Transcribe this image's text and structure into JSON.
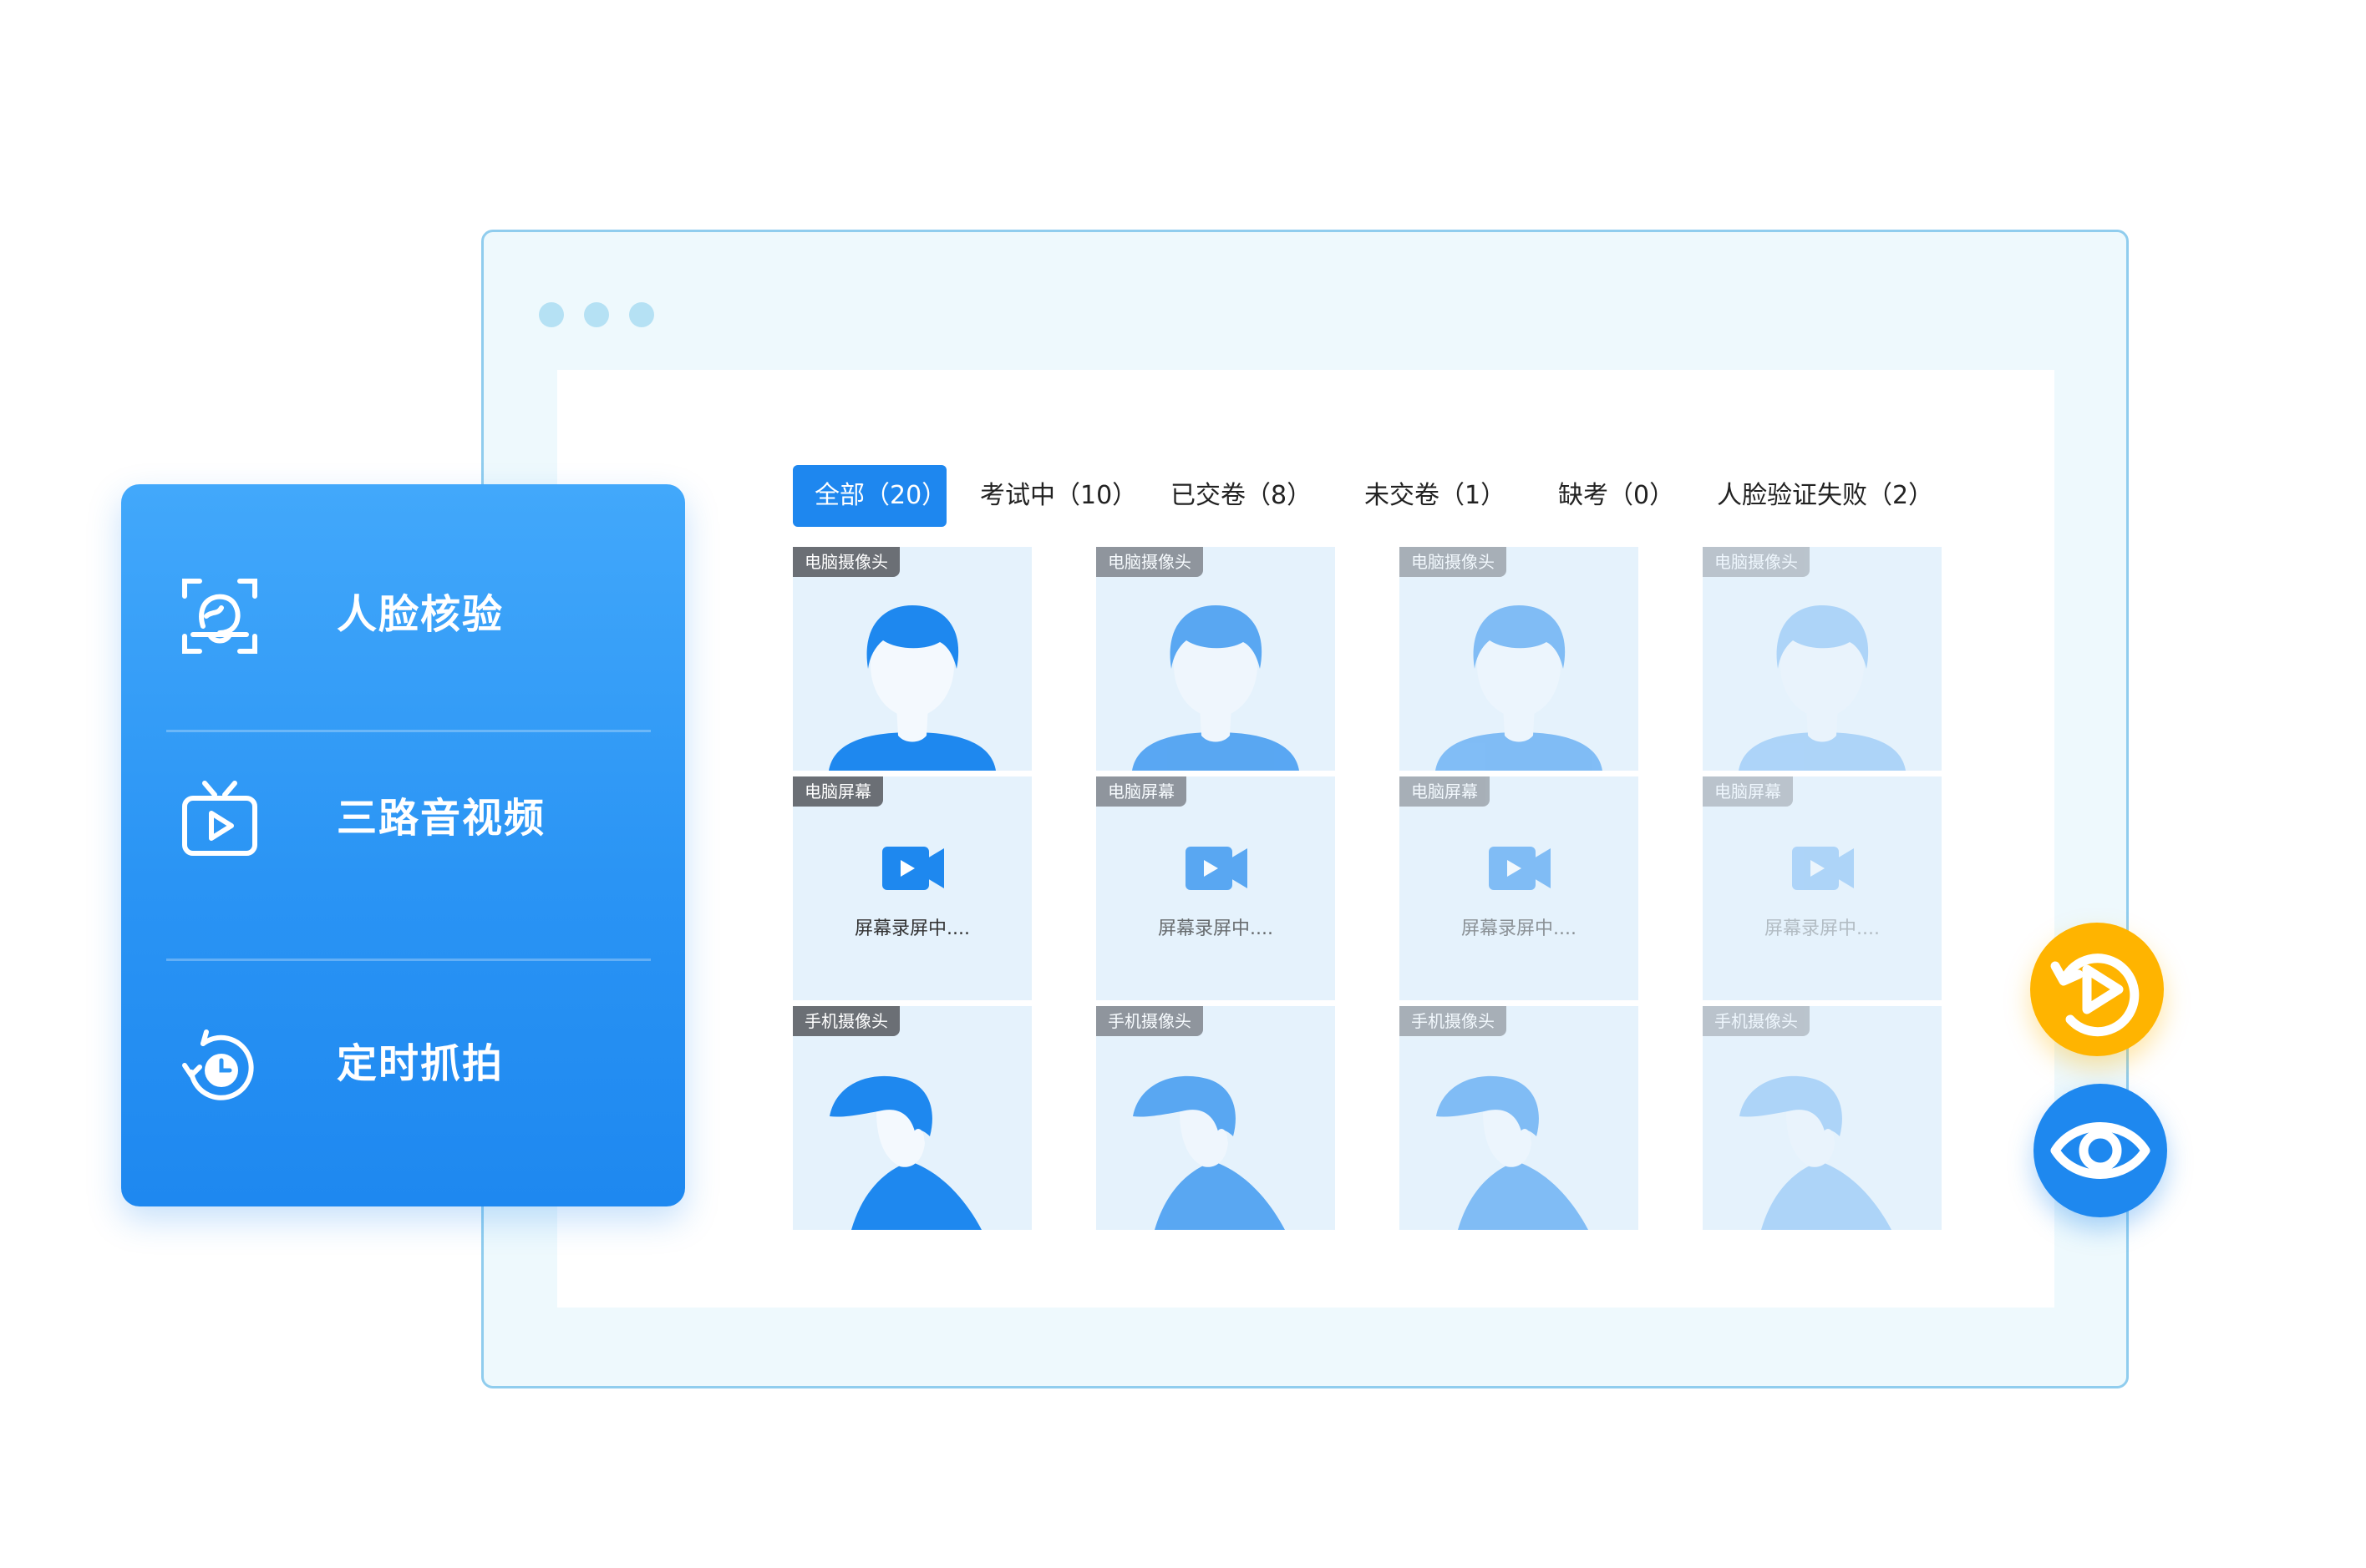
{
  "tabs": [
    {
      "label": "全部（20）",
      "active": true
    },
    {
      "label": "考试中（10）",
      "active": false
    },
    {
      "label": "已交卷（8）",
      "active": false
    },
    {
      "label": "未交卷（1）",
      "active": false
    },
    {
      "label": "缺考（0）",
      "active": false
    },
    {
      "label": "人脸验证失败（2）",
      "active": false
    }
  ],
  "grid": {
    "rows": [
      {
        "label": "电脑摄像头",
        "kind": "camera-front"
      },
      {
        "label": "电脑屏幕",
        "kind": "screen",
        "text": "屏幕录屏中...."
      },
      {
        "label": "手机摄像头",
        "kind": "camera-side"
      }
    ],
    "column_opacity": [
      1.0,
      0.7,
      0.5,
      0.28
    ]
  },
  "features": [
    {
      "label": "人脸核验",
      "icon": "face-scan-icon"
    },
    {
      "label": "三路音视频",
      "icon": "tv-play-icon"
    },
    {
      "label": "定时抓拍",
      "icon": "timer-capture-icon"
    }
  ],
  "actions": {
    "replay_icon": "replay-icon",
    "view_icon": "eye-icon"
  },
  "colors": {
    "accent": "#1e87ef",
    "replay": "#ffb400",
    "tile_bg": "#e5f2fc",
    "figure": "#1e88ef",
    "skin": "#f4f9fe"
  }
}
